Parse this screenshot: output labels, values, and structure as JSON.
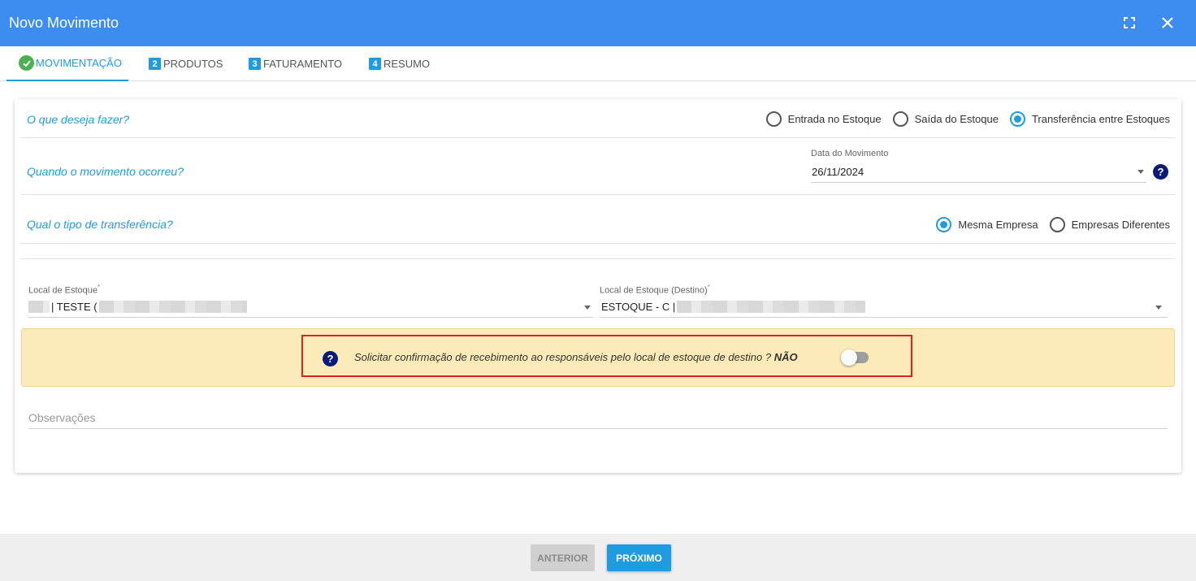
{
  "window": {
    "title": "Novo Movimento",
    "maximize_icon": "maximize-icon",
    "close_icon": "close-icon"
  },
  "tabs": [
    {
      "label": "MOVIMENTAÇÃO",
      "badge": "",
      "state": "completed"
    },
    {
      "label": "PRODUTOS",
      "badge": "2",
      "state": "pending"
    },
    {
      "label": "FATURAMENTO",
      "badge": "3",
      "state": "pending"
    },
    {
      "label": "RESUMO",
      "badge": "4",
      "state": "pending"
    }
  ],
  "q1": {
    "question": "O que deseja fazer?",
    "options": [
      "Entrada no Estoque",
      "Saída do Estoque",
      "Transferência entre Estoques"
    ],
    "selected": "Transferência entre Estoques"
  },
  "q2": {
    "question": "Quando o movimento ocorreu?",
    "label": "Data do Movimento",
    "value": "26/11/2024"
  },
  "q3": {
    "question": "Qual o tipo de transferência?",
    "options": [
      "Mesma Empresa",
      "Empresas Diferentes"
    ],
    "selected": "Mesma Empresa"
  },
  "origem": {
    "label": "Local de Estoque",
    "required": "*",
    "value": "| TESTE ("
  },
  "destino": {
    "label": "Local de Estoque (Destino)",
    "required": "*",
    "value": "ESTOQUE - C |"
  },
  "notice": {
    "text": "Solicitar confirmação de recebimento ao responsáveis pelo local de estoque de destino ?",
    "status": "NÃO",
    "toggle_on": false
  },
  "observacoes": {
    "placeholder": "Observações"
  },
  "footer": {
    "prev_label": "ANTERIOR",
    "next_label": "PRÓXIMO"
  },
  "colors": {
    "header": "#3d8cf0",
    "accent": "#1f9be0",
    "notice_bg": "#fcebb8",
    "highlight": "#e02020"
  }
}
